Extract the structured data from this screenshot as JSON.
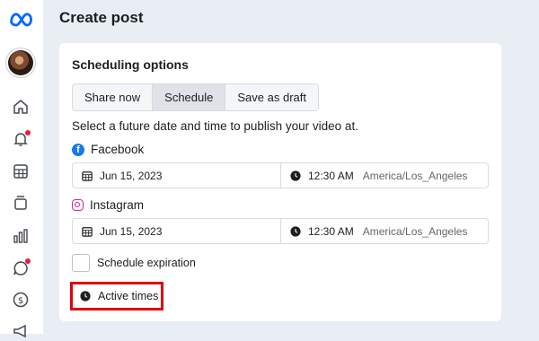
{
  "sidebar": {
    "items": [
      {
        "icon": "home-icon"
      },
      {
        "icon": "bell-icon",
        "badge": true
      },
      {
        "icon": "calendar-grid-icon"
      },
      {
        "icon": "layers-icon"
      },
      {
        "icon": "bar-chart-icon"
      },
      {
        "icon": "chat-bubble-icon",
        "badge": true
      },
      {
        "icon": "dollar-icon"
      },
      {
        "icon": "megaphone-icon"
      }
    ]
  },
  "page": {
    "title": "Create post"
  },
  "scheduling": {
    "title": "Scheduling options",
    "tabs": [
      {
        "label": "Share now",
        "active": false
      },
      {
        "label": "Schedule",
        "active": true
      },
      {
        "label": "Save as draft",
        "active": false
      }
    ],
    "helper": "Select a future date and time to publish your video at.",
    "facebook": {
      "label": "Facebook",
      "date": "Jun 15, 2023",
      "time": "12:30 AM",
      "timezone": "America/Los_Angeles"
    },
    "instagram": {
      "label": "Instagram",
      "date": "Jun 15, 2023",
      "time": "12:30 AM",
      "timezone": "America/Los_Angeles"
    },
    "expiration_label": "Schedule expiration",
    "active_times_label": "Active times"
  },
  "colors": {
    "accent": "#1877f2",
    "highlight_box": "#e0000d",
    "notification_dot": "#e41e3f"
  }
}
